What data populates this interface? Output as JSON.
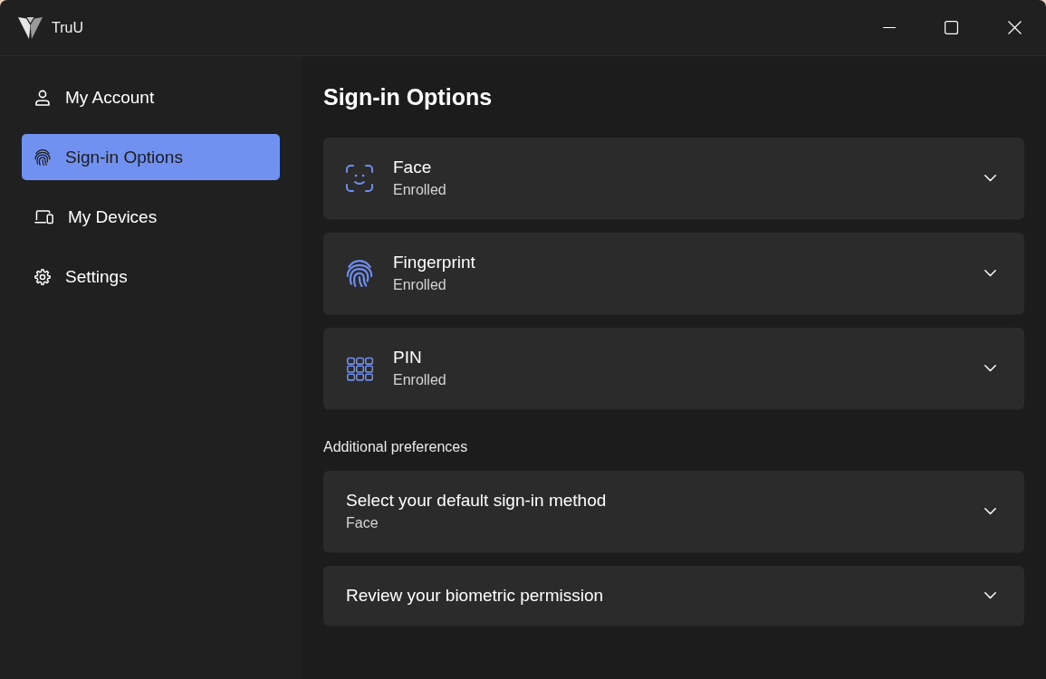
{
  "window": {
    "title": "TruU"
  },
  "sidebar": {
    "items": [
      {
        "label": "My Account",
        "selected": false
      },
      {
        "label": "Sign-in Options",
        "selected": true
      },
      {
        "label": "My Devices",
        "selected": false
      },
      {
        "label": "Settings",
        "selected": false
      }
    ]
  },
  "page": {
    "title": "Sign-in Options"
  },
  "methods": [
    {
      "name": "Face",
      "status": "Enrolled",
      "expanded": false
    },
    {
      "name": "Fingerprint",
      "status": "Enrolled",
      "expanded": false
    },
    {
      "name": "PIN",
      "status": "Enrolled",
      "expanded": false
    }
  ],
  "preferences": {
    "heading": "Additional preferences",
    "items": [
      {
        "title": "Select your default sign-in method",
        "value": "Face",
        "expanded": false
      },
      {
        "title": "Review your biometric permission",
        "expanded": false
      }
    ]
  }
}
